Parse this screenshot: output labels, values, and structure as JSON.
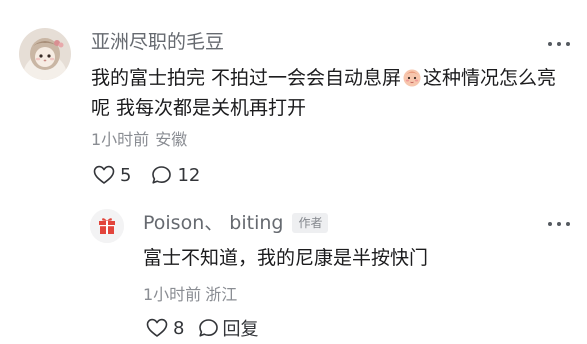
{
  "comment": {
    "username": "亚洲尽职的毛豆",
    "body_part1": "我的富士拍完 不拍过一会会自动息屏",
    "body_emoji": "baby-face-emoji",
    "body_part2": "这种情况怎么亮呢 我每次都是关机再打开",
    "time": "1小时前",
    "location": "安徽",
    "likes": "5",
    "comments": "12",
    "avatar_icon": "doll-avatar"
  },
  "reply": {
    "username": "Poison、 biting",
    "author_badge": "作者",
    "body": "富士不知道，我的尼康是半按快门",
    "time": "1小时前",
    "location": "浙江",
    "likes": "8",
    "reply_label": "回复",
    "avatar_icon": "gift-avatar"
  },
  "colors": {
    "username": "#666a70",
    "body_text": "#1c1c1e",
    "meta": "#8a8d93",
    "icon": "#333539",
    "gift_red": "#e2453c"
  }
}
